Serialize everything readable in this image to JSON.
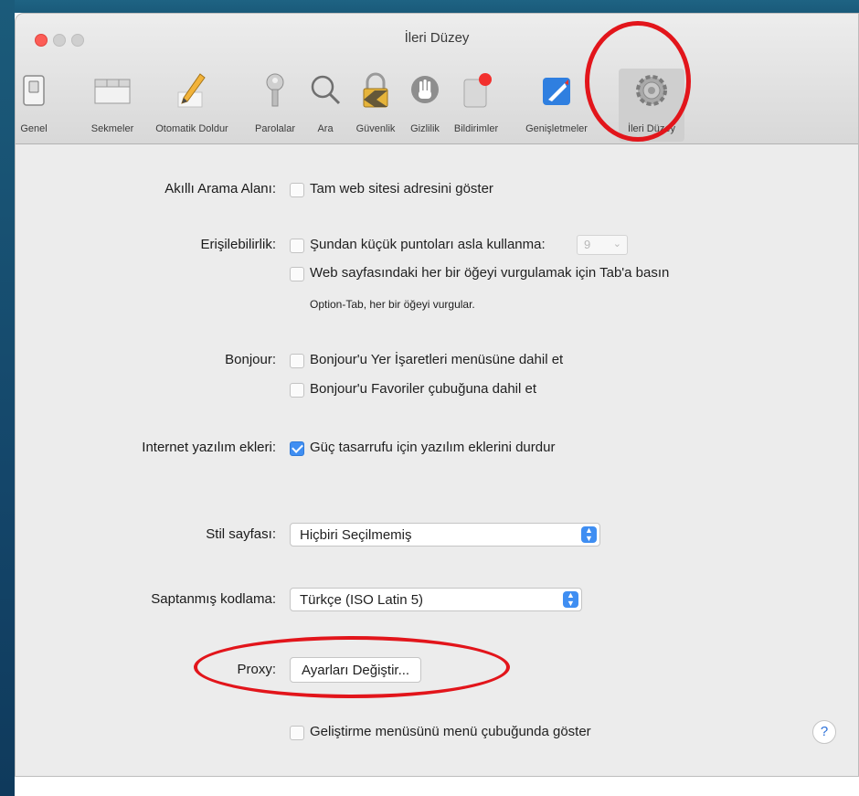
{
  "window": {
    "title": "İleri Düzey"
  },
  "toolbar": {
    "items": [
      {
        "label": "Genel",
        "icon": "switch-icon"
      },
      {
        "label": "Sekmeler",
        "icon": "tabs-icon"
      },
      {
        "label": "Otomatik Doldur",
        "icon": "pencil-icon"
      },
      {
        "label": "Parolalar",
        "icon": "key-icon"
      },
      {
        "label": "Ara",
        "icon": "search-icon"
      },
      {
        "label": "Güvenlik",
        "icon": "lock-icon"
      },
      {
        "label": "Gizlilik",
        "icon": "hand-icon"
      },
      {
        "label": "Bildirimler",
        "icon": "notification-icon"
      },
      {
        "label": "Genişletmeler",
        "icon": "puzzle-icon"
      },
      {
        "label": "İleri Düzey",
        "icon": "gear-icon"
      }
    ]
  },
  "settings": {
    "smart_search": {
      "label": "Akıllı Arama Alanı:",
      "option": "Tam web sitesi adresini göster",
      "checked": false
    },
    "accessibility": {
      "label": "Erişilebilirlik:",
      "option1": "Şundan küçük puntoları asla kullanma:",
      "font_size": "9",
      "option2": "Web sayfasındaki her bir öğeyi vurgulamak için Tab'a basın",
      "note": "Option-Tab, her bir öğeyi vurgular."
    },
    "bonjour": {
      "label": "Bonjour:",
      "option1": "Bonjour'u Yer İşaretleri menüsüne dahil et",
      "option2": "Bonjour'u Favoriler çubuğuna dahil et"
    },
    "plugins": {
      "label": "Internet yazılım ekleri:",
      "option": "Güç tasarrufu için yazılım eklerini durdur",
      "checked": true
    },
    "stylesheet": {
      "label": "Stil sayfası:",
      "value": "Hiçbiri Seçilmemiş"
    },
    "encoding": {
      "label": "Saptanmış kodlama:",
      "value": "Türkçe (ISO Latin 5)"
    },
    "proxy": {
      "label": "Proxy:",
      "button": "Ayarları Değiştir..."
    },
    "develop": {
      "option": "Geliştirme menüsünü menü çubuğunda göster",
      "checked": false
    },
    "help": "?"
  },
  "colors": {
    "accent": "#3f8ef2",
    "highlight_red": "#e2151b",
    "close_button": "#fc5d57"
  }
}
